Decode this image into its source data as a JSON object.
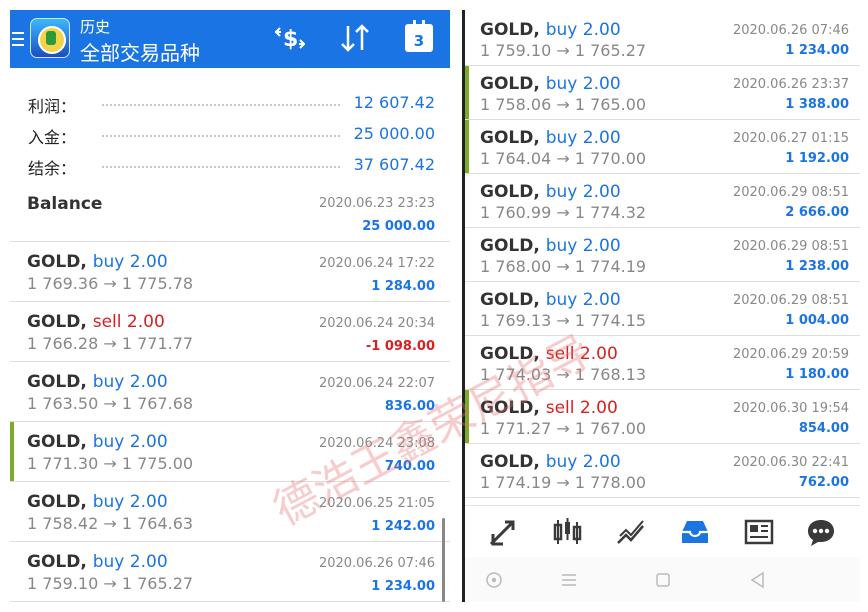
{
  "header": {
    "subtitle": "历史",
    "title": "全部交易品种",
    "calendar_day": "3"
  },
  "summary": [
    {
      "label": "利润：",
      "value": "12 607.42"
    },
    {
      "label": "入金：",
      "value": "25 000.00"
    },
    {
      "label": "结余：",
      "value": "37 607.42"
    }
  ],
  "balance_row": {
    "title": "Balance",
    "time": "2020.06.23 23:23",
    "profit": "25 000.00"
  },
  "left_trades": [
    {
      "symbol": "GOLD,",
      "dir": "buy",
      "volume": "2.00",
      "open": "1 769.36",
      "close": "1 775.78",
      "time": "2020.06.24 17:22",
      "profit": "1 284.00",
      "neg": false,
      "marked": false
    },
    {
      "symbol": "GOLD,",
      "dir": "sell",
      "volume": "2.00",
      "open": "1 766.28",
      "close": "1 771.77",
      "time": "2020.06.24 20:34",
      "profit": "-1 098.00",
      "neg": true,
      "marked": false
    },
    {
      "symbol": "GOLD,",
      "dir": "buy",
      "volume": "2.00",
      "open": "1 763.50",
      "close": "1 767.68",
      "time": "2020.06.24 22:07",
      "profit": "836.00",
      "neg": false,
      "marked": false
    },
    {
      "symbol": "GOLD,",
      "dir": "buy",
      "volume": "2.00",
      "open": "1 771.30",
      "close": "1 775.00",
      "time": "2020.06.24 23:08",
      "profit": "740.00",
      "neg": false,
      "marked": true
    },
    {
      "symbol": "GOLD,",
      "dir": "buy",
      "volume": "2.00",
      "open": "1 758.42",
      "close": "1 764.63",
      "time": "2020.06.25 21:05",
      "profit": "1 242.00",
      "neg": false,
      "marked": false
    },
    {
      "symbol": "GOLD,",
      "dir": "buy",
      "volume": "2.00",
      "open": "1 759.10",
      "close": "1 765.27",
      "time": "2020.06.26 07:46",
      "profit": "1 234.00",
      "neg": false,
      "marked": false
    }
  ],
  "right_trades": [
    {
      "symbol": "GOLD,",
      "dir": "buy",
      "volume": "2.00",
      "open": "1 759.10",
      "close": "1 765.27",
      "time": "2020.06.26 07:46",
      "profit": "1 234.00",
      "neg": false,
      "marked": false
    },
    {
      "symbol": "GOLD,",
      "dir": "buy",
      "volume": "2.00",
      "open": "1 758.06",
      "close": "1 765.00",
      "time": "2020.06.26 23:37",
      "profit": "1 388.00",
      "neg": false,
      "marked": true
    },
    {
      "symbol": "GOLD,",
      "dir": "buy",
      "volume": "2.00",
      "open": "1 764.04",
      "close": "1 770.00",
      "time": "2020.06.27 01:15",
      "profit": "1 192.00",
      "neg": false,
      "marked": true
    },
    {
      "symbol": "GOLD,",
      "dir": "buy",
      "volume": "2.00",
      "open": "1 760.99",
      "close": "1 774.32",
      "time": "2020.06.29 08:51",
      "profit": "2 666.00",
      "neg": false,
      "marked": false
    },
    {
      "symbol": "GOLD,",
      "dir": "buy",
      "volume": "2.00",
      "open": "1 768.00",
      "close": "1 774.19",
      "time": "2020.06.29 08:51",
      "profit": "1 238.00",
      "neg": false,
      "marked": false
    },
    {
      "symbol": "GOLD,",
      "dir": "buy",
      "volume": "2.00",
      "open": "1 769.13",
      "close": "1 774.15",
      "time": "2020.06.29 08:51",
      "profit": "1 004.00",
      "neg": false,
      "marked": false
    },
    {
      "symbol": "GOLD,",
      "dir": "sell",
      "volume": "2.00",
      "open": "1 774.03",
      "close": "1 768.13",
      "time": "2020.06.29 20:59",
      "profit": "1 180.00",
      "neg": false,
      "marked": false
    },
    {
      "symbol": "GOLD,",
      "dir": "sell",
      "volume": "2.00",
      "open": "1 771.27",
      "close": "1 767.00",
      "time": "2020.06.30 19:54",
      "profit": "854.00",
      "neg": false,
      "marked": true
    },
    {
      "symbol": "GOLD,",
      "dir": "buy",
      "volume": "2.00",
      "open": "1 774.19",
      "close": "1 778.00",
      "time": "2020.06.30 22:41",
      "profit": "762.00",
      "neg": false,
      "marked": false
    }
  ],
  "arrow": "→",
  "watermark": "德浩王鑫荣尼指导",
  "toolbar_icons": [
    "quotes-icon",
    "chart-icon",
    "trade-icon",
    "history-icon",
    "news-icon",
    "chat-icon"
  ],
  "colors": {
    "accent": "#1a74e3",
    "sell": "#d92020",
    "mark": "#7cab2a"
  }
}
